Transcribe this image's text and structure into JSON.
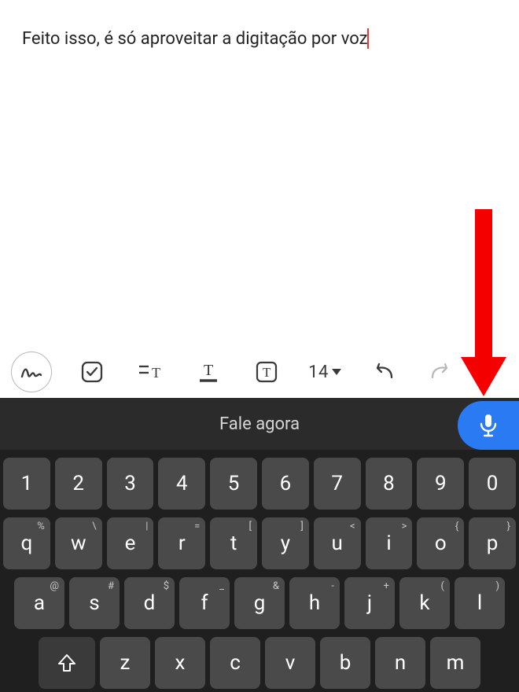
{
  "editor": {
    "text": "Feito isso, é só aproveitar a digitação por voz"
  },
  "toolbar": {
    "font_size": "14"
  },
  "keyboard_bar": {
    "prompt": "Fale agora"
  },
  "keys": {
    "row1": [
      {
        "main": "1",
        "sup": ""
      },
      {
        "main": "2",
        "sup": ""
      },
      {
        "main": "3",
        "sup": ""
      },
      {
        "main": "4",
        "sup": ""
      },
      {
        "main": "5",
        "sup": ""
      },
      {
        "main": "6",
        "sup": ""
      },
      {
        "main": "7",
        "sup": ""
      },
      {
        "main": "8",
        "sup": ""
      },
      {
        "main": "9",
        "sup": ""
      },
      {
        "main": "0",
        "sup": ""
      }
    ],
    "row2": [
      {
        "main": "q",
        "sup": "%"
      },
      {
        "main": "w",
        "sup": "\\"
      },
      {
        "main": "e",
        "sup": "|"
      },
      {
        "main": "r",
        "sup": "="
      },
      {
        "main": "t",
        "sup": "["
      },
      {
        "main": "y",
        "sup": "]"
      },
      {
        "main": "u",
        "sup": "<"
      },
      {
        "main": "i",
        "sup": ">"
      },
      {
        "main": "o",
        "sup": "{"
      },
      {
        "main": "p",
        "sup": "}"
      }
    ],
    "row3": [
      {
        "main": "a",
        "sup": "@"
      },
      {
        "main": "s",
        "sup": "#"
      },
      {
        "main": "d",
        "sup": "$"
      },
      {
        "main": "f",
        "sup": "_"
      },
      {
        "main": "g",
        "sup": "&"
      },
      {
        "main": "h",
        "sup": "-"
      },
      {
        "main": "j",
        "sup": "+"
      },
      {
        "main": "k",
        "sup": "("
      },
      {
        "main": "l",
        "sup": ")"
      }
    ],
    "row4": [
      {
        "main": "z",
        "sup": ""
      },
      {
        "main": "x",
        "sup": ""
      },
      {
        "main": "c",
        "sup": ""
      },
      {
        "main": "v",
        "sup": ""
      },
      {
        "main": "b",
        "sup": ""
      },
      {
        "main": "n",
        "sup": ""
      },
      {
        "main": "m",
        "sup": ""
      }
    ]
  }
}
